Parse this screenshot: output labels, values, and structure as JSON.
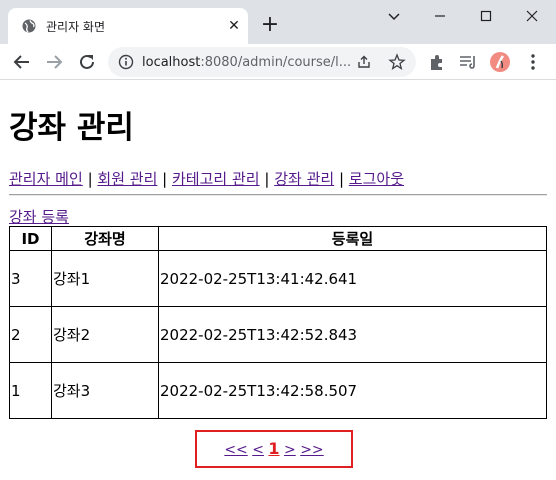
{
  "browser": {
    "tab_title": "관리자 화면",
    "url_host": "localhost",
    "url_rest": ":8080/admin/course/l..."
  },
  "page": {
    "title": "강좌 관리",
    "nav": [
      {
        "label": "관리자 메인"
      },
      {
        "label": "회원 관리"
      },
      {
        "label": "카테고리 관리"
      },
      {
        "label": "강좌 관리"
      },
      {
        "label": "로그아웃"
      }
    ],
    "nav_separator": "|",
    "register_link": "강좌 등록",
    "table": {
      "headers": [
        "ID",
        "강좌명",
        "등록일"
      ],
      "rows": [
        {
          "id": "3",
          "name": "강좌1",
          "date": "2022-02-25T13:41:42.641"
        },
        {
          "id": "2",
          "name": "강좌2",
          "date": "2022-02-25T13:42:52.843"
        },
        {
          "id": "1",
          "name": "강좌3",
          "date": "2022-02-25T13:42:58.507"
        }
      ]
    },
    "pager": {
      "first": "<<",
      "prev": "<",
      "current": "1",
      "next": ">",
      "last": ">>"
    }
  },
  "colors": {
    "link": "#551a8b",
    "highlight_box": "#e02020"
  }
}
